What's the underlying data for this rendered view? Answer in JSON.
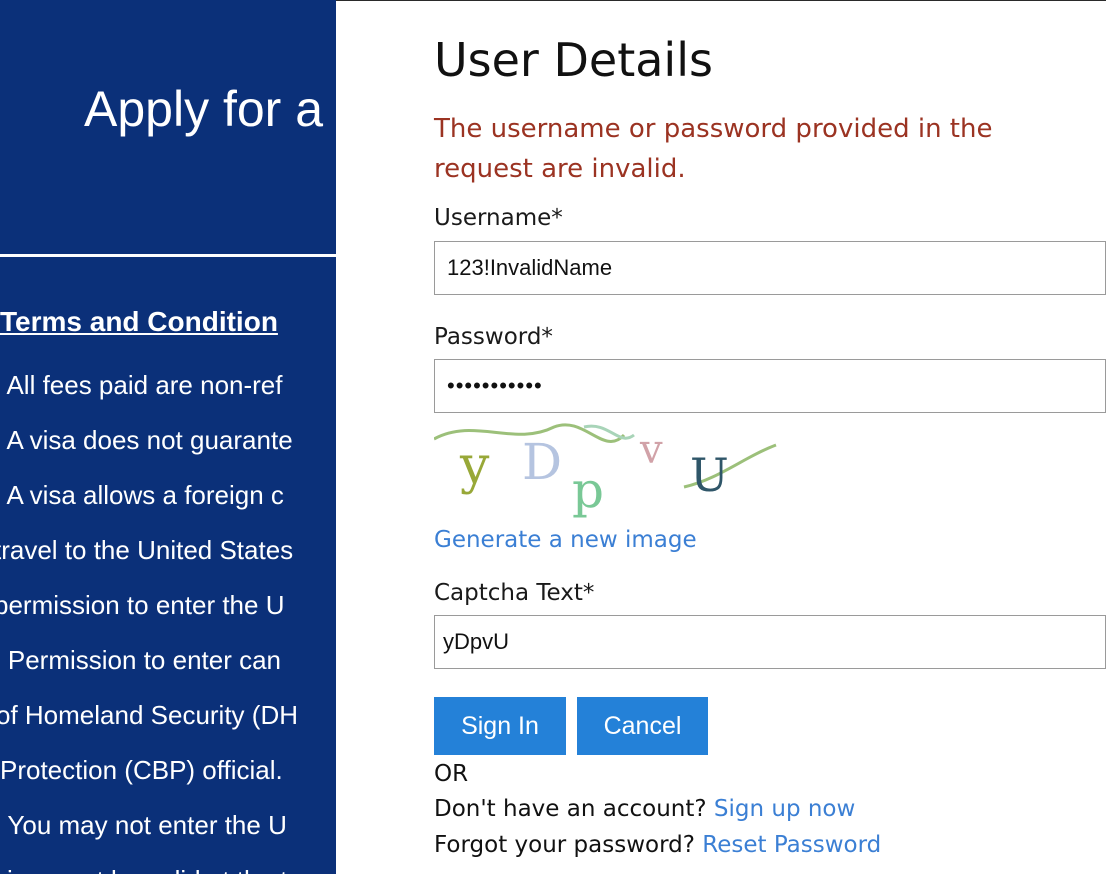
{
  "background_page": {
    "title": "Apply for a",
    "terms_heading": "Terms and Condition",
    "lines": [
      "- All fees paid are non-ref",
      "- A visa does not guarante",
      "- A visa allows a foreign c",
      "travel to the United States",
      "permission to enter the U",
      "- Permission to enter can",
      "of Homeland Security (DH",
      "Protection (CBP) official.",
      "- You may not enter the U",
      "visa must be valid at the t"
    ]
  },
  "dialog": {
    "title": "User Details",
    "error_message": "The username or password provided in the request are invalid.",
    "username": {
      "label": "Username*",
      "value": "123!InvalidName"
    },
    "password": {
      "label": "Password*",
      "value": "•••••••••••"
    },
    "captcha": {
      "image_text": "yDpvU",
      "link_text": "Generate a new image"
    },
    "captcha_text": {
      "label": "Captcha Text*",
      "value": "yDpvU"
    },
    "buttons": {
      "sign_in": "Sign In",
      "cancel": "Cancel"
    },
    "or_text": "OR",
    "signup": {
      "prompt": "Don't have an account?",
      "link": "Sign up now"
    },
    "reset": {
      "prompt": "Forgot your password?",
      "link": "Reset Password"
    }
  },
  "colors": {
    "background_page": "#0b3079",
    "error": "#9b3322",
    "link": "#3b7fd4",
    "button": "#2481d8"
  }
}
